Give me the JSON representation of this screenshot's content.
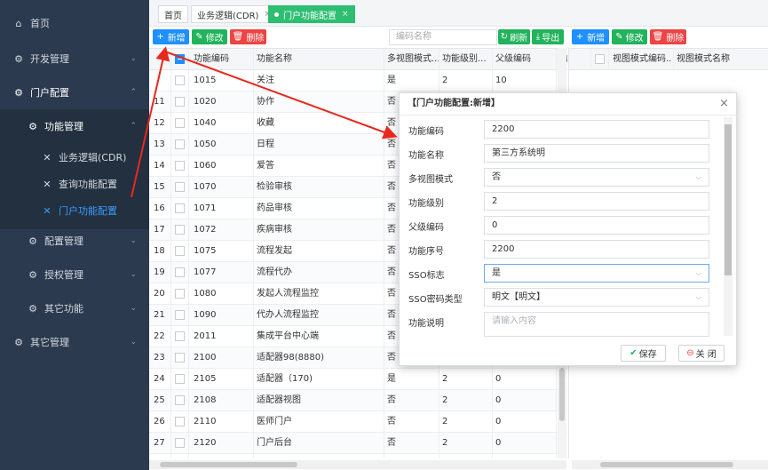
{
  "sidebar": {
    "items": [
      {
        "label": "首页",
        "icon": "home-icon"
      },
      {
        "label": "开发管理",
        "icon": "gear-icon"
      },
      {
        "label": "门户配置",
        "icon": "gear-icon"
      },
      {
        "label": "功能管理",
        "icon": "gear-icon"
      },
      {
        "label": "业务逻辑(CDR)",
        "icon": "wrench-icon"
      },
      {
        "label": "查询功能配置",
        "icon": "wrench-icon"
      },
      {
        "label": "门户功能配置",
        "icon": "wrench-icon"
      },
      {
        "label": "配置管理",
        "icon": "gear-icon"
      },
      {
        "label": "授权管理",
        "icon": "gear-icon"
      },
      {
        "label": "其它功能",
        "icon": "gear-icon"
      },
      {
        "label": "其它管理",
        "icon": "gear-icon"
      }
    ]
  },
  "tabs": [
    {
      "label": "首页"
    },
    {
      "label": "业务逻辑(CDR)"
    },
    {
      "label": "门户功能配置"
    }
  ],
  "toolbar": {
    "add": "新增",
    "edit": "修改",
    "delete": "删除",
    "search_placeholder": "编码名称",
    "refresh": "刷新",
    "export": "导出"
  },
  "right_toolbar": {
    "add": "新增",
    "edit": "修改",
    "delete": "删除"
  },
  "grid": {
    "columns": [
      "功能编码",
      "功能名称",
      "多视图模式...",
      "功能级别...",
      "父级编码",
      "功"
    ],
    "rows": [
      {
        "no": "",
        "code": "1015",
        "name": "关注",
        "multi": "是",
        "level": "2",
        "parent": "10"
      },
      {
        "no": "11",
        "code": "1020",
        "name": "协作",
        "multi": "否",
        "level": "",
        "parent": ""
      },
      {
        "no": "12",
        "code": "1040",
        "name": "收藏",
        "multi": "否",
        "level": "",
        "parent": ""
      },
      {
        "no": "13",
        "code": "1050",
        "name": "日程",
        "multi": "否",
        "level": "",
        "parent": ""
      },
      {
        "no": "14",
        "code": "1060",
        "name": "爱答",
        "multi": "否",
        "level": "",
        "parent": ""
      },
      {
        "no": "15",
        "code": "1070",
        "name": "检验审核",
        "multi": "否",
        "level": "",
        "parent": ""
      },
      {
        "no": "16",
        "code": "1071",
        "name": "药品审核",
        "multi": "否",
        "level": "",
        "parent": ""
      },
      {
        "no": "17",
        "code": "1072",
        "name": "疾病审核",
        "multi": "否",
        "level": "",
        "parent": ""
      },
      {
        "no": "18",
        "code": "1075",
        "name": "流程发起",
        "multi": "否",
        "level": "",
        "parent": ""
      },
      {
        "no": "19",
        "code": "1077",
        "name": "流程代办",
        "multi": "否",
        "level": "",
        "parent": ""
      },
      {
        "no": "20",
        "code": "1080",
        "name": "发起人流程监控",
        "multi": "否",
        "level": "",
        "parent": ""
      },
      {
        "no": "21",
        "code": "1090",
        "name": "代办人流程监控",
        "multi": "否",
        "level": "",
        "parent": ""
      },
      {
        "no": "22",
        "code": "2011",
        "name": "集成平台中心端",
        "multi": "否",
        "level": "",
        "parent": ""
      },
      {
        "no": "23",
        "code": "2100",
        "name": "适配器98(8880)",
        "multi": "否",
        "level": "",
        "parent": ""
      },
      {
        "no": "24",
        "code": "2105",
        "name": "适配器（170)",
        "multi": "是",
        "level": "2",
        "parent": "0"
      },
      {
        "no": "25",
        "code": "2108",
        "name": "适配器视图",
        "multi": "否",
        "level": "2",
        "parent": "0"
      },
      {
        "no": "26",
        "code": "2110",
        "name": "医师门户",
        "multi": "否",
        "level": "2",
        "parent": "0"
      },
      {
        "no": "27",
        "code": "2120",
        "name": "门户后台",
        "multi": "否",
        "level": "2",
        "parent": "0"
      }
    ]
  },
  "right_grid": {
    "columns": [
      "视图模式编码...",
      "视图模式名称"
    ]
  },
  "modal": {
    "title": "【门户功能配置:新增】",
    "fields": [
      {
        "label": "功能编码",
        "value": "2200",
        "placeholder": ""
      },
      {
        "label": "功能名称",
        "value": "第三方系统明",
        "placeholder": ""
      },
      {
        "label": "多视图模式",
        "value": "否",
        "placeholder": ""
      },
      {
        "label": "功能级别",
        "value": "2",
        "placeholder": ""
      },
      {
        "label": "父级编码",
        "value": "0",
        "placeholder": ""
      },
      {
        "label": "功能序号",
        "value": "2200",
        "placeholder": ""
      },
      {
        "label": "SSO标志",
        "value": "是",
        "placeholder": ""
      },
      {
        "label": "SSO密码类型",
        "value": "明文【明文】",
        "placeholder": ""
      },
      {
        "label": "功能说明",
        "value": "",
        "placeholder": "请输入内容"
      }
    ],
    "save": "保存",
    "close": "关 闭"
  },
  "colors": {
    "sidebar_bg": "#2b3a4e",
    "active_tab": "#2dbe72",
    "primary": "#1e90ff",
    "danger": "#ee4444",
    "annotation": "#e8281f"
  }
}
